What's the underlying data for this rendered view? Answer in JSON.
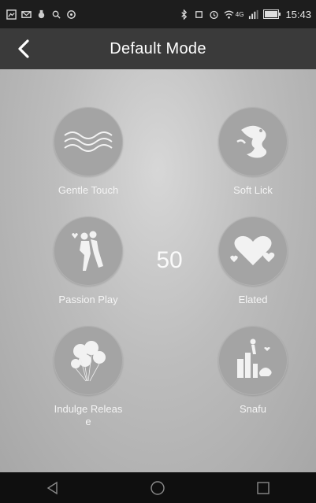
{
  "status_bar": {
    "time": "15:43",
    "network": "4G"
  },
  "header": {
    "title": "Default Mode"
  },
  "modes": [
    {
      "label": "Gentle Touch",
      "icon": "waves-icon"
    },
    {
      "label": "Soft Lick",
      "icon": "dragon-icon"
    },
    {
      "label": "Passion Play",
      "icon": "dancing-couple-icon"
    },
    {
      "label": "Elated",
      "icon": "hearts-icon"
    },
    {
      "label": "Indulge Releas\ne",
      "icon": "balloons-icon"
    },
    {
      "label": "Snafu",
      "icon": "city-figure-icon"
    }
  ],
  "intensity": {
    "value": "50"
  }
}
